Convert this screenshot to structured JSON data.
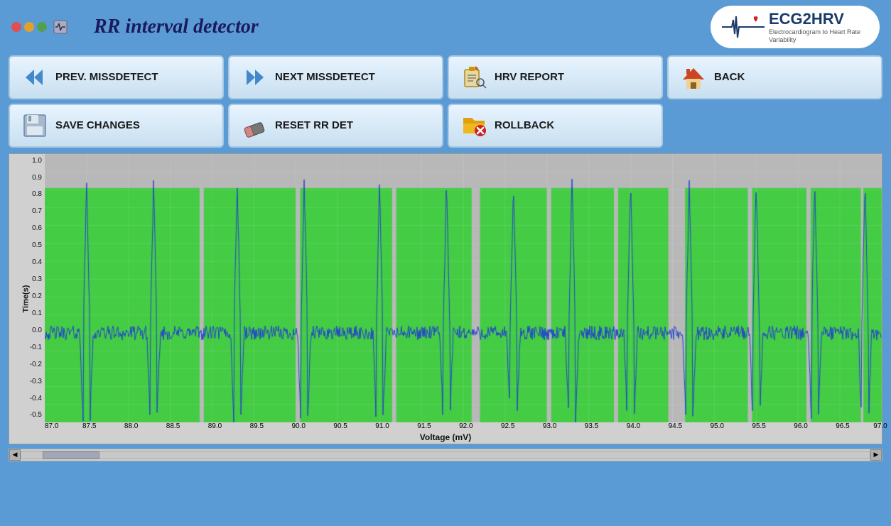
{
  "window": {
    "title": "RR interval detector"
  },
  "logo": {
    "text": "ECG2HRV",
    "subtitle": "Electrocardiogram to Heart Rate Variability"
  },
  "buttons": [
    {
      "id": "prev-missdetect",
      "label": "PREV. MISSDETECT",
      "icon": "rewind"
    },
    {
      "id": "next-missdetect",
      "label": "NEXT MISSDETECT",
      "icon": "forward"
    },
    {
      "id": "hrv-report",
      "label": "HRV REPORT",
      "icon": "report"
    },
    {
      "id": "back",
      "label": "BACK",
      "icon": "home"
    },
    {
      "id": "save-changes",
      "label": "SAVE CHANGES",
      "icon": "save"
    },
    {
      "id": "reset-rr-det",
      "label": "RESET RR DET",
      "icon": "eraser"
    },
    {
      "id": "rollback",
      "label": "ROLLBACK",
      "icon": "rollback"
    }
  ],
  "chart": {
    "y_axis_title": "Time(s)",
    "x_axis_title": "Voltage (mV)",
    "y_labels": [
      "1.0",
      "0.9",
      "0.8",
      "0.7",
      "0.6",
      "0.5",
      "0.4",
      "0.3",
      "0.2",
      "0.1",
      "0.0",
      "-0.1",
      "-0.2",
      "-0.3",
      "-0.4",
      "-0.5"
    ],
    "x_labels": [
      "87.0",
      "87.5",
      "88.0",
      "88.5",
      "89.0",
      "89.5",
      "90.0",
      "90.5",
      "91.0",
      "91.5",
      "92.0",
      "92.5",
      "93.0",
      "93.5",
      "94.0",
      "94.5",
      "95.0",
      "95.5",
      "96.0",
      "96.5",
      "97.0"
    ]
  }
}
